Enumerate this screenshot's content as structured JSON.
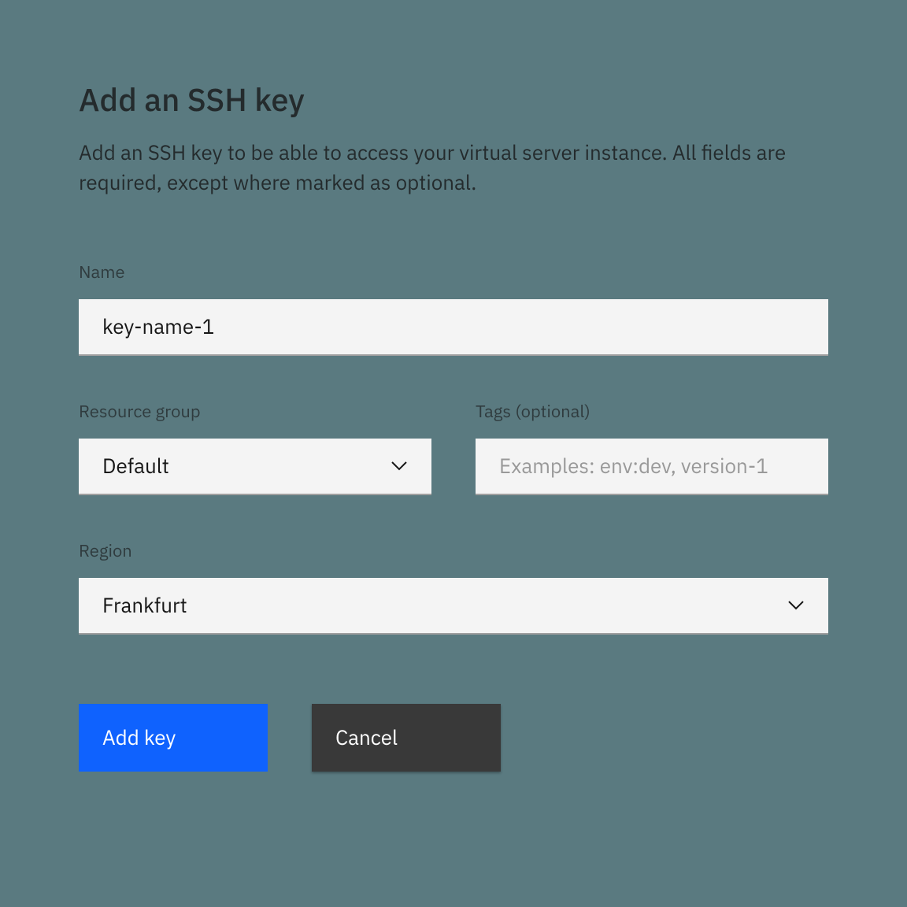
{
  "header": {
    "title": "Add an SSH key",
    "description": "Add an SSH key to be able to access your virtual server instance. All fields are required, except where marked as optional."
  },
  "fields": {
    "name": {
      "label": "Name",
      "value": "key-name-1"
    },
    "resource_group": {
      "label": "Resource group",
      "value": "Default"
    },
    "tags": {
      "label": "Tags (optional)",
      "placeholder": "Examples: env:dev, version-1",
      "value": ""
    },
    "region": {
      "label": "Region",
      "value": "Frankfurt"
    }
  },
  "buttons": {
    "primary": "Add key",
    "secondary": "Cancel"
  }
}
